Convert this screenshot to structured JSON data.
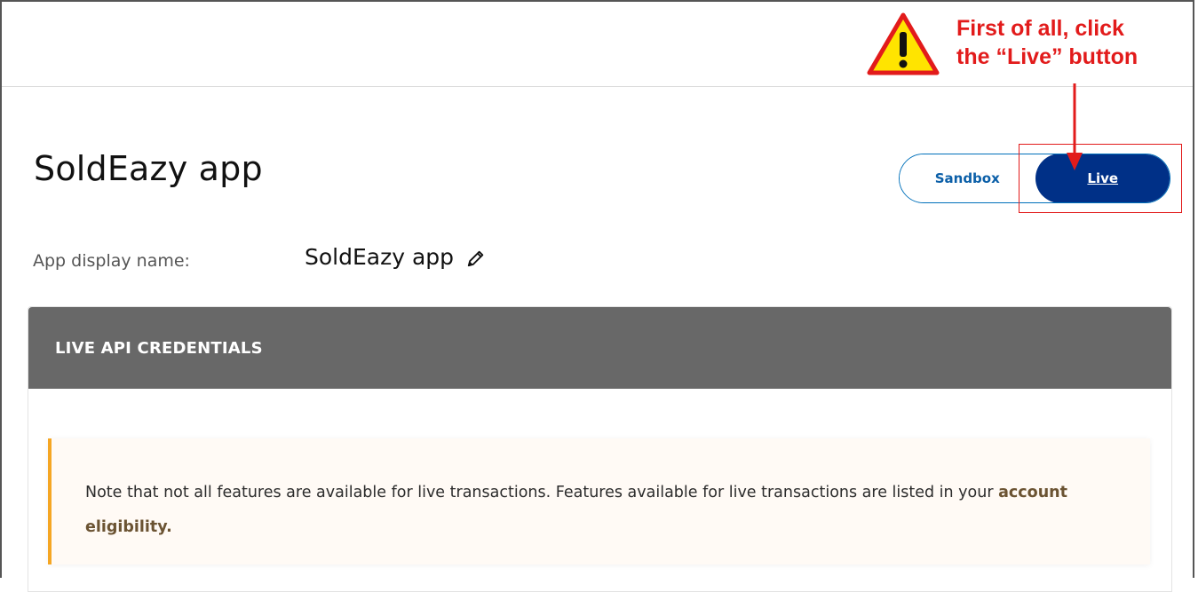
{
  "page": {
    "title": "SoldEazy app"
  },
  "env_toggle": {
    "sandbox_label": "Sandbox",
    "live_label": "Live",
    "selected": "Live"
  },
  "display_name": {
    "label": "App display name:",
    "value": "SoldEazy app",
    "edit_icon": "pencil-icon"
  },
  "credentials_card": {
    "header": "LIVE API CREDENTIALS",
    "notice_text": "Note that not all features are available for live transactions. Features available for live transactions are listed in your ",
    "notice_link": "account eligibility."
  },
  "annotation": {
    "line1": "First of all, click",
    "line2": "the “Live” button",
    "icon": "warning-icon",
    "color": "#e21b1b"
  },
  "colors": {
    "primary_blue": "#003087",
    "toggle_border": "#0070ba",
    "card_header": "#686868",
    "notice_accent": "#f5a623"
  }
}
